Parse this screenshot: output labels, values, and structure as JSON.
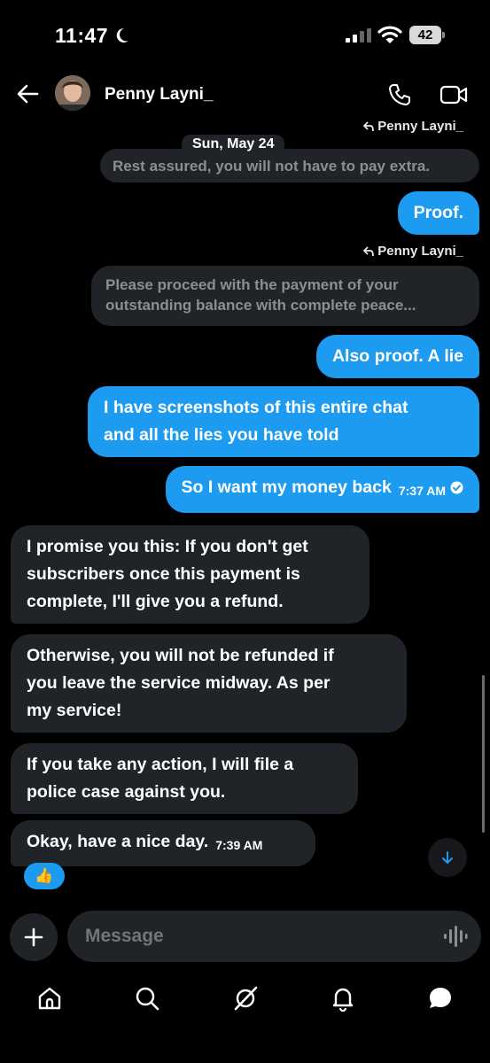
{
  "status_bar": {
    "time": "11:47",
    "battery": "42"
  },
  "header": {
    "contact_name": "Penny Layni_"
  },
  "chat": {
    "date_label": "Sun, May 24",
    "messages": [
      {
        "reply_to": "Penny Layni_",
        "quote": "Rest assured, you will not have to pay extra."
      },
      {
        "text": "Proof."
      },
      {
        "reply_to": "Penny Layni_",
        "quote_line1": "Please proceed with the payment of your",
        "quote_line2": "outstanding balance with complete peace..."
      },
      {
        "text": "Also proof. A lie"
      },
      {
        "line1": "I have screenshots of this entire chat",
        "line2": "and all the lies you have told"
      },
      {
        "text": "So I want my money back",
        "time": "7:37 AM"
      },
      {
        "line1": "I promise you this: If you don't get",
        "line2": "subscribers once this payment is",
        "line3": "complete, I'll give you a refund."
      },
      {
        "line1": "Otherwise, you will not be refunded if",
        "line2": "you leave the service midway. As per",
        "line3": "my service!"
      },
      {
        "line1": "If you take any action, I will file a",
        "line2": "police case against you."
      },
      {
        "text": "Okay, have a nice day.",
        "time": "7:39 AM",
        "reaction": "👍"
      }
    ]
  },
  "composer": {
    "placeholder": "Message"
  },
  "nav": [
    "home-icon",
    "search-icon",
    "grok-icon",
    "notifications-icon",
    "messages-icon"
  ]
}
